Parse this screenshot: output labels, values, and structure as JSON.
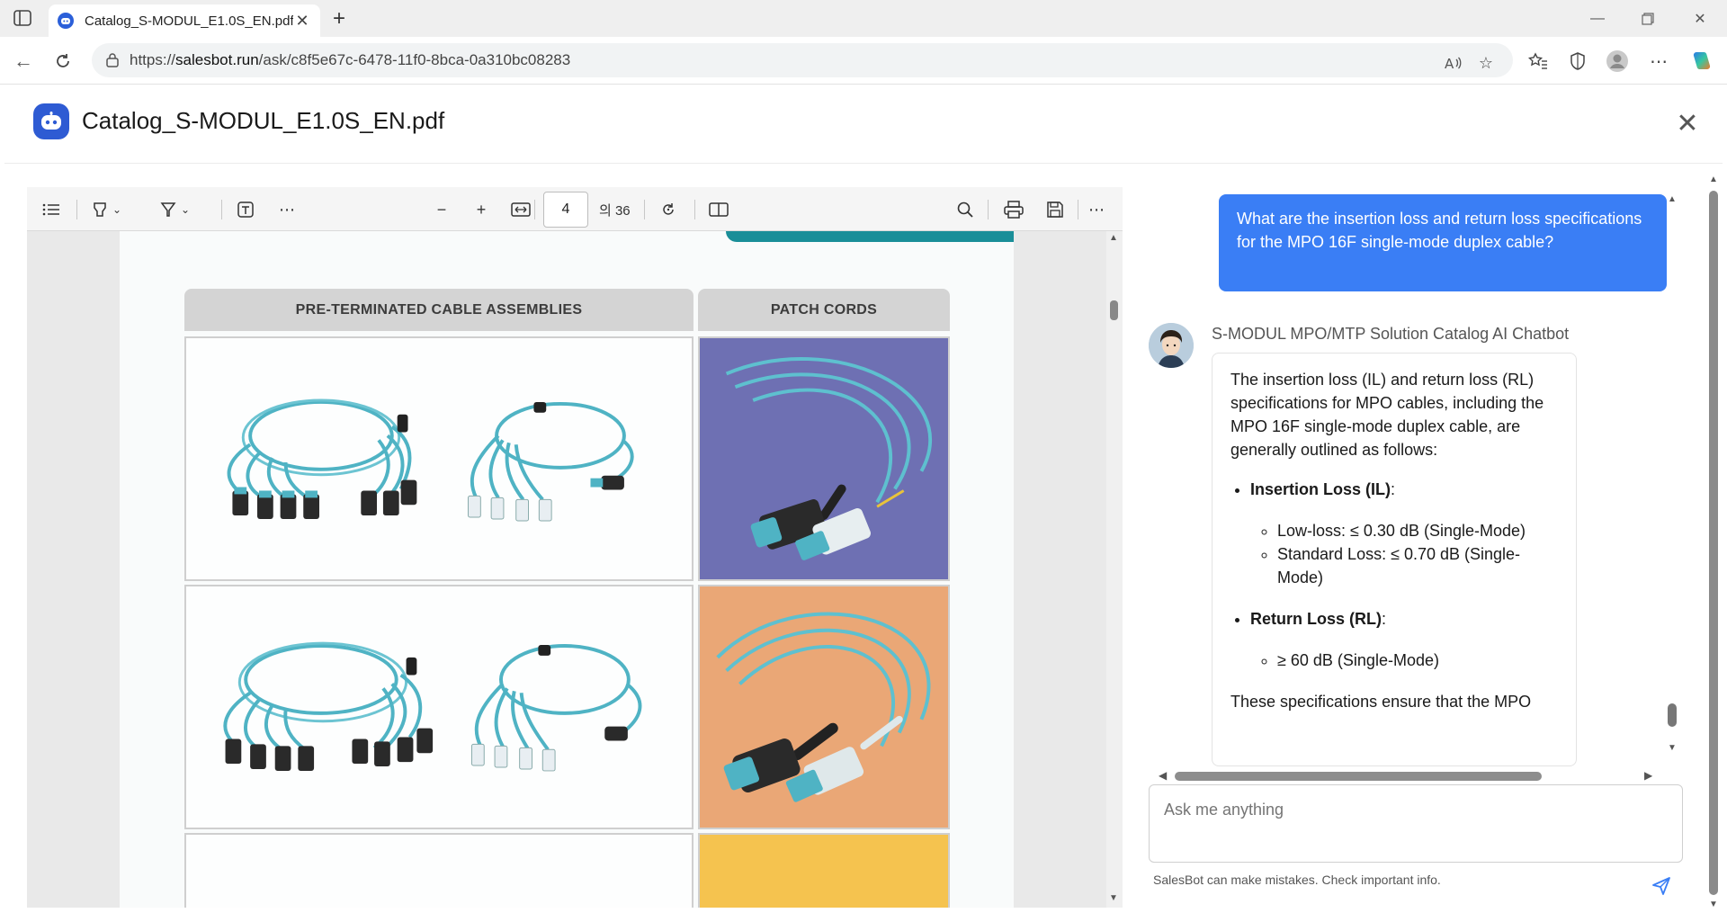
{
  "browser": {
    "tab_title": "Catalog_S-MODUL_E1.0S_EN.pdf",
    "url_host": "salesbot.run",
    "url_prefix": "https://",
    "url_path": "/ask/c8f5e67c-6478-11f0-8bca-0a310bc08283"
  },
  "modal": {
    "title": "Catalog_S-MODUL_E1.0S_EN.pdf"
  },
  "pdf": {
    "current_page": "4",
    "total_pages": "의 36",
    "col_left_header": "PRE-TERMINATED CABLE ASSEMBLIES",
    "col_right_header": "PATCH CORDS"
  },
  "chat": {
    "user_message": "What are the insertion loss and return loss specifications for the MPO 16F single-mode duplex cable?",
    "bot_name": "S-MODUL MPO/MTP Solution Catalog AI Chatbot",
    "bot_intro": "The insertion loss (IL) and return loss (RL) specifications for MPO cables, including the MPO 16F single-mode duplex cable, are generally outlined as follows:",
    "il_heading": "Insertion Loss (IL)",
    "il_low": "Low-loss: ≤ 0.30 dB (Single-Mode)",
    "il_standard": "Standard Loss: ≤ 0.70 dB (Single-Mode)",
    "rl_heading": "Return Loss (RL)",
    "rl_value": "≥ 60 dB (Single-Mode)",
    "bot_outro": "These specifications ensure that the MPO",
    "input_placeholder": "Ask me anything",
    "disclaimer": "SalesBot can make mistakes. Check important info."
  },
  "colors": {
    "accent_blue": "#3a7ef5",
    "brand_blue": "#2e5bd3",
    "teal_cable": "#4fb3c4"
  }
}
